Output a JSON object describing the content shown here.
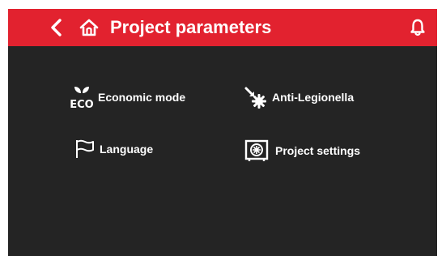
{
  "header": {
    "title": "Project parameters",
    "back_icon": "chevron-left-icon",
    "home_icon": "home-icon",
    "bell_icon": "bell-icon"
  },
  "menu": {
    "items": [
      {
        "label": "Economic mode",
        "icon": "eco-icon",
        "icon_text": "ECO"
      },
      {
        "label": "Anti-Legionella",
        "icon": "anti-legionella-icon"
      },
      {
        "label": "Language",
        "icon": "flag-icon"
      },
      {
        "label": "Project settings",
        "icon": "project-settings-icon"
      }
    ]
  },
  "colors": {
    "header_bg": "#e2222f",
    "screen_bg": "#242424",
    "text": "#ffffff"
  }
}
